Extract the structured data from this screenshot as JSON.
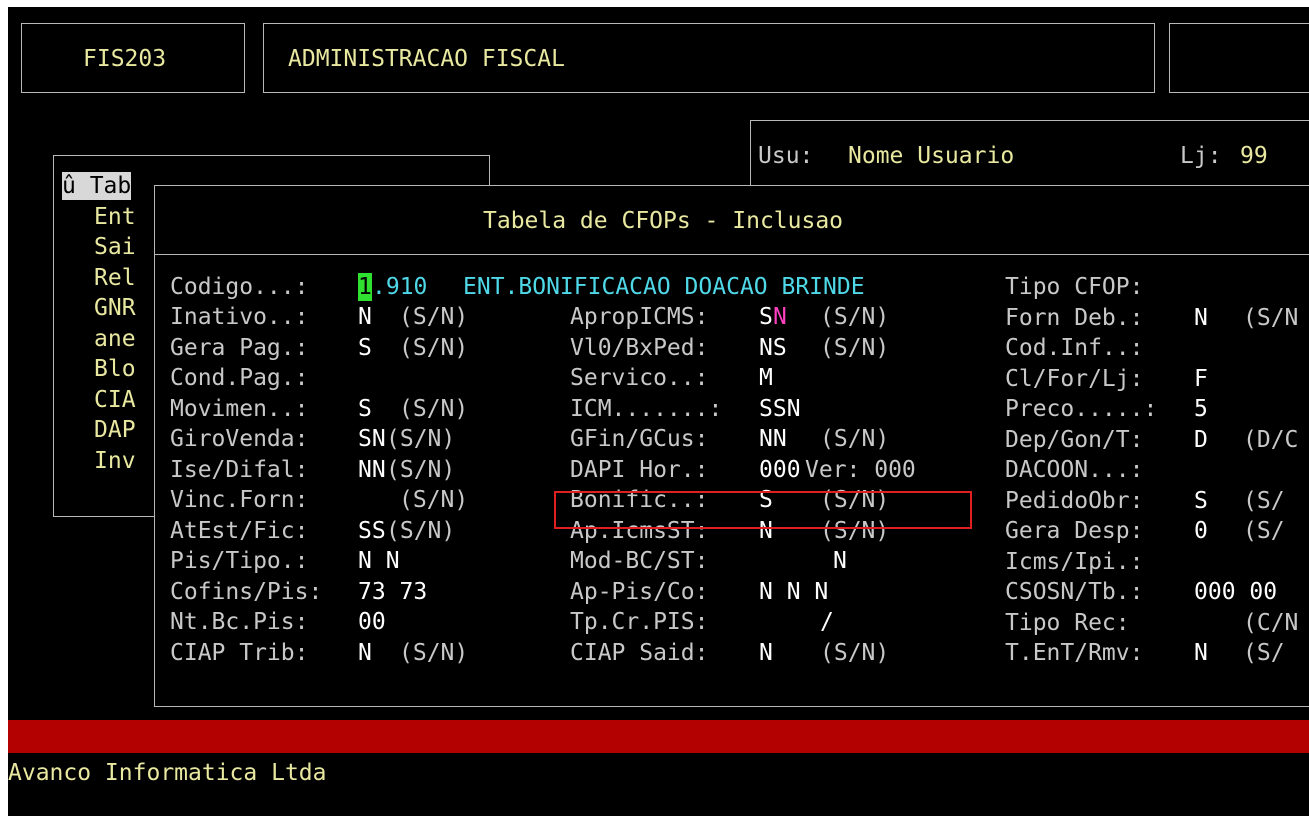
{
  "header": {
    "program_code": "FIS203",
    "module_title": "ADMINISTRACAO FISCAL"
  },
  "session": {
    "user_label": "Usu:",
    "user_name": "Nome Usuario",
    "store_label": "Lj:",
    "store_value": "99"
  },
  "menu": {
    "items": [
      "û Tab",
      "Ent",
      "Sai",
      "Rel",
      "GNR",
      "ane",
      "Blo",
      "CIA",
      "DAP",
      "Inv"
    ]
  },
  "dialog": {
    "title": "Tabela de CFOPs - Inclusao",
    "codigo": {
      "label": "Codigo...:",
      "cursor_char": "1",
      "rest": ".910",
      "description": "ENT.BONIFICACAO DOACAO BRINDE"
    },
    "col1": [
      {
        "label": "Inativo..:",
        "value": "N",
        "hint": "(S/N)"
      },
      {
        "label": "Gera Pag.:",
        "value": "S",
        "hint": "(S/N)"
      },
      {
        "label": "Cond.Pag.:",
        "value": "",
        "hint": ""
      },
      {
        "label": "Movimen..:",
        "value": "S",
        "hint": "(S/N)"
      },
      {
        "label": "GiroVenda:",
        "value": "SN",
        "hint": "(S/N)"
      },
      {
        "label": "Ise/Difal:",
        "value": "NN",
        "hint": "(S/N)"
      },
      {
        "label": "Vinc.Forn:",
        "value": "",
        "hint": "(S/N)"
      },
      {
        "label": "AtEst/Fic:",
        "value": "SS",
        "hint": "(S/N)"
      },
      {
        "label": "Pis/Tipo.:",
        "value": "N N",
        "hint": ""
      },
      {
        "label": "Cofins/Pis:",
        "value": "73 73",
        "hint": ""
      },
      {
        "label": "Nt.Bc.Pis:",
        "value": "00",
        "hint": ""
      },
      {
        "label": "CIAP Trib:",
        "value": "N",
        "hint": "(S/N)"
      }
    ],
    "col2": [
      {
        "label": "ApropICMS:",
        "value": "S",
        "value2": "N",
        "hint": "(S/N)"
      },
      {
        "label": "Vl0/BxPed:",
        "value": "NS",
        "hint": "(S/N)"
      },
      {
        "label": "Servico..:",
        "value": "M",
        "hint": ""
      },
      {
        "label": "ICM.......:",
        "value": "SSN",
        "hint": ""
      },
      {
        "label": "GFin/GCus:",
        "value": "NN",
        "hint": "(S/N)"
      },
      {
        "label": "DAPI Hor.:",
        "value": "000",
        "hint": "Ver: 000"
      },
      {
        "label": "Bonific..:",
        "value": "S",
        "hint": "(S/N)"
      },
      {
        "label": "Ap.IcmsST:",
        "value": "N",
        "hint": "(S/N)"
      },
      {
        "label": "Mod-BC/ST:",
        "value": "N",
        "hint": ""
      },
      {
        "label": "Ap-Pis/Co:",
        "value": "N N N",
        "hint": ""
      },
      {
        "label": "Tp.Cr.PIS:",
        "value": "/",
        "hint": ""
      },
      {
        "label": "CIAP Said:",
        "value": "N",
        "hint": "(S/N)"
      }
    ],
    "col3": [
      {
        "label": "Tipo CFOP:",
        "value": "",
        "hint": ""
      },
      {
        "label": "Forn Deb.:",
        "value": "N",
        "hint": "(S/N"
      },
      {
        "label": "Cod.Inf..:",
        "value": "",
        "hint": ""
      },
      {
        "label": "Cl/For/Lj:",
        "value": "F",
        "hint": ""
      },
      {
        "label": "Preco.....:",
        "value": "5",
        "hint": ""
      },
      {
        "label": "Dep/Gon/T:",
        "value": "D",
        "hint": "(D/C"
      },
      {
        "label": "DACOON...:",
        "value": "",
        "hint": ""
      },
      {
        "label": "PedidoObr:",
        "value": "S",
        "hint": "(S/"
      },
      {
        "label": "Gera Desp:",
        "value": "0",
        "hint": "(S/"
      },
      {
        "label": "Icms/Ipi.:",
        "value": "",
        "hint": ""
      },
      {
        "label": "CSOSN/Tb.:",
        "value": "000 00",
        "hint": ""
      },
      {
        "label": "Tipo Rec:",
        "value": "",
        "hint": "(C/N"
      },
      {
        "label": "T.EnT/Rmv:",
        "value": "N",
        "hint": "(S/"
      }
    ]
  },
  "footer": {
    "company": "Avanco Informatica Ltda"
  },
  "colors": {
    "background": "#000000",
    "status_bar": "#b30000",
    "highlight_box": "#e02020",
    "cursor": "#30e030"
  }
}
